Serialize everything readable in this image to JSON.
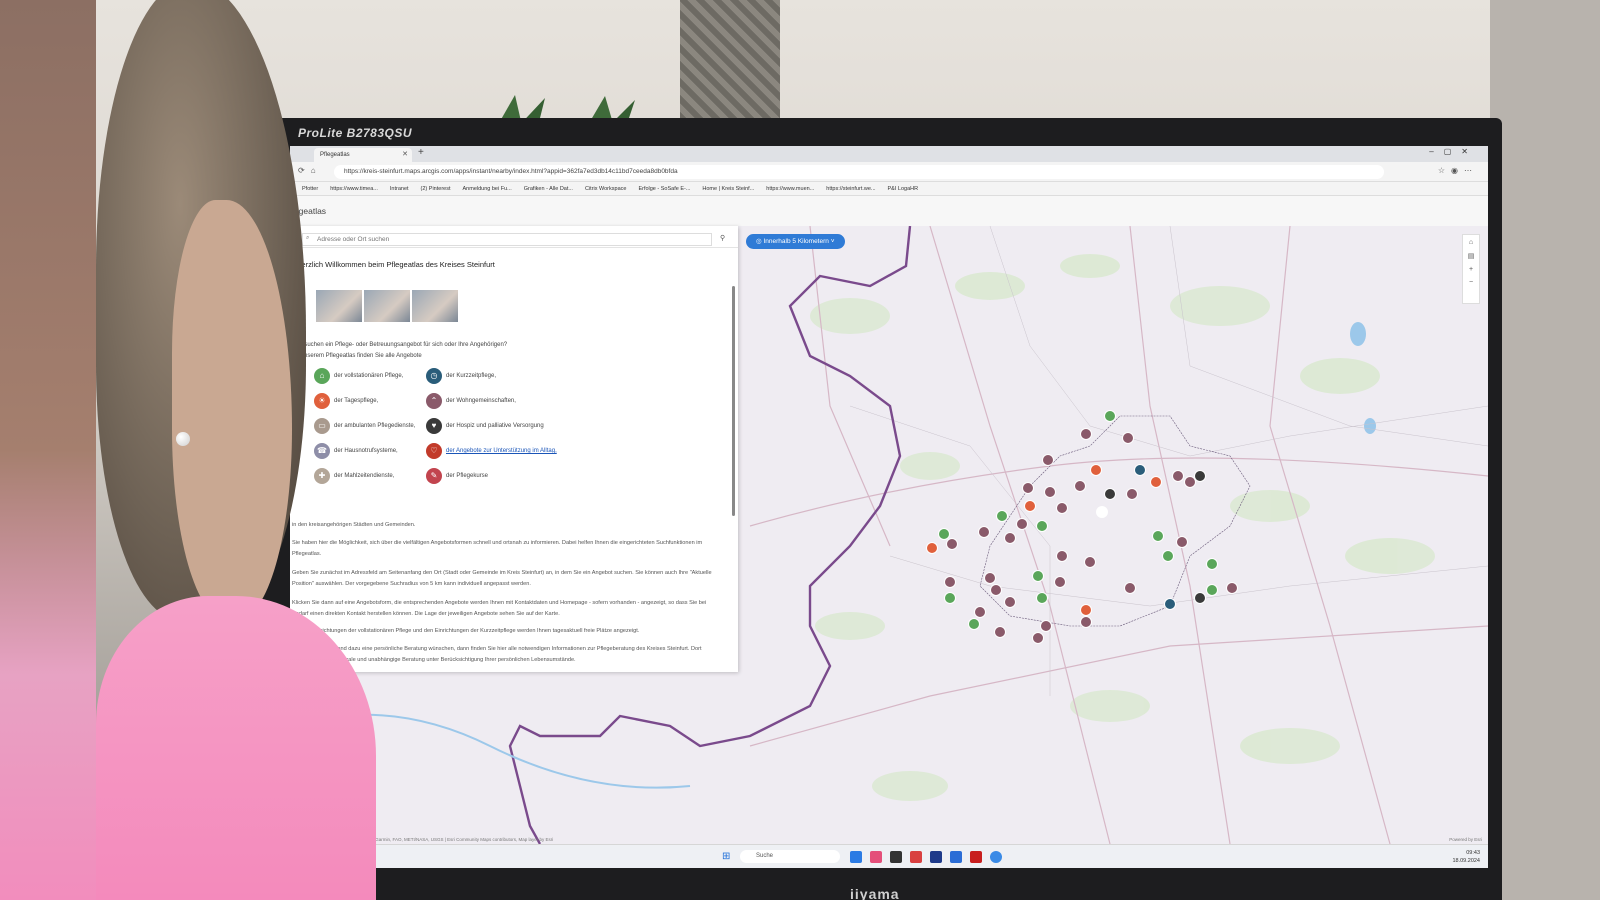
{
  "monitor": {
    "model": "ProLite B2783QSU",
    "brand": "iiyama"
  },
  "browser": {
    "tab_title": "Pflegeatlas",
    "url": "https://kreis-steinfurt.maps.arcgis.com/apps/instant/nearby/index.html?appid=362fa7ed3db14c11bd7ceeda8db0bfda",
    "bookmarks": [
      "Pfotter",
      "https://www.timea...",
      "Intranet",
      "(2) Pinterest",
      "Anmeldung bei Fu...",
      "Grafiken - Alle Dat...",
      "Citrix Workspace",
      "Erfolge - SoSafe E-...",
      "Home | Kreis Steinf...",
      "https://www.muen...",
      "https://steinfurt.we...",
      "P&I LogaHR"
    ]
  },
  "app": {
    "title": "Pflegeatlas",
    "search_placeholder": "Adresse oder Ort suchen",
    "radius_chip": "Innerhalb 5 Kilometern"
  },
  "panel": {
    "welcome": "Herzlich Willkommen beim Pflegeatlas des Kreises Steinfurt",
    "intro_1": "Sie suchen ein Pflege- oder Betreuungsangebot für sich oder Ihre Angehörigen?",
    "intro_2": "In unserem Pflegeatlas finden Sie alle Angebote",
    "legend": [
      {
        "label": "der vollstationären Pflege,",
        "color": "#5aa65a",
        "icon": "house-icon"
      },
      {
        "label": "der Kurzzeitpflege,",
        "color": "#2a5d7a",
        "icon": "clock-icon"
      },
      {
        "label": "der Tagespflege,",
        "color": "#e0603c",
        "icon": "sun-icon"
      },
      {
        "label": "der Wohngemeinschaften,",
        "color": "#8a5a6a",
        "icon": "roof-icon"
      },
      {
        "label": "der ambulanten Pflegedienste,",
        "color": "#a99a8e",
        "icon": "car-icon"
      },
      {
        "label": "der Hospiz und palliative Versorgung",
        "color": "#3a3a3a",
        "icon": "heart-icon"
      },
      {
        "label": "der Hausnotrufsysteme,",
        "color": "#8e8ea8",
        "icon": "alarm-icon"
      },
      {
        "label": "der Angebote zur Unterstützung im Alltag,",
        "color": "#c23a2a",
        "icon": "hands-icon"
      },
      {
        "label": "der Mahlzeitendienste,",
        "color": "#b3a698",
        "icon": "meal-icon"
      },
      {
        "label": "der Pflegekurse",
        "color": "#c2444e",
        "icon": "course-icon"
      }
    ],
    "para_1": "in den kreisangehörigen Städten und Gemeinden.",
    "para_2": "Sie haben hier die Möglichkeit, sich über die vielfältigen Angebotsformen schnell und ortsnah zu informieren. Dabei helfen Ihnen die eingerichteten Suchfunktionen im Pflegeatlas.",
    "para_3": "Geben Sie zunächst im Adressfeld am Seitenanfang den Ort (Stadt oder Gemeinde im Kreis Steinfurt) an, in dem Sie ein Angebot suchen. Sie können auch Ihre \"Aktuelle Position\" auswählen. Der vorgegebene Suchradius von 5 km kann individuell angepasst werden.",
    "para_4": "Klicken Sie dann auf eine Angebotsform, die entsprechenden Angebote werden Ihnen mit Kontaktdaten und Homepage - sofern vorhanden - angezeigt, so dass Sie bei Bedarf einen direkten Kontakt herstellen können. Die Lage der jeweiligen Angebote sehen Sie auf der Karte.",
    "para_5": "Bei den Einrichtungen der vollstationären Pflege und den Einrichtungen der Kurzzeitpflege werden Ihnen tagesaktuell freie Plätze angezeigt.",
    "para_6": "Sollten Sie ergänzend dazu eine persönliche Beratung wünschen, dann finden Sie hier alle notwendigen Informationen zur Pflegeberatung des Kreises Steinfurt. Dort erhalten Sie eine neutrale und unabhängige Beratung unter Berücksichtigung Ihrer persönlichen Lebensumstände."
  },
  "map": {
    "attribution": "Esri, HERE, Garmin, FAO, METI/NASA, USGS | Esri Community Maps contributors, Map layer by Esri",
    "powered": "Powered by Esri"
  },
  "taskbar": {
    "search": "Suche",
    "time": "09:43",
    "date": "18.09.2024"
  },
  "colors": {
    "accent": "#2f7bd6",
    "border": "#7a4a8c"
  }
}
